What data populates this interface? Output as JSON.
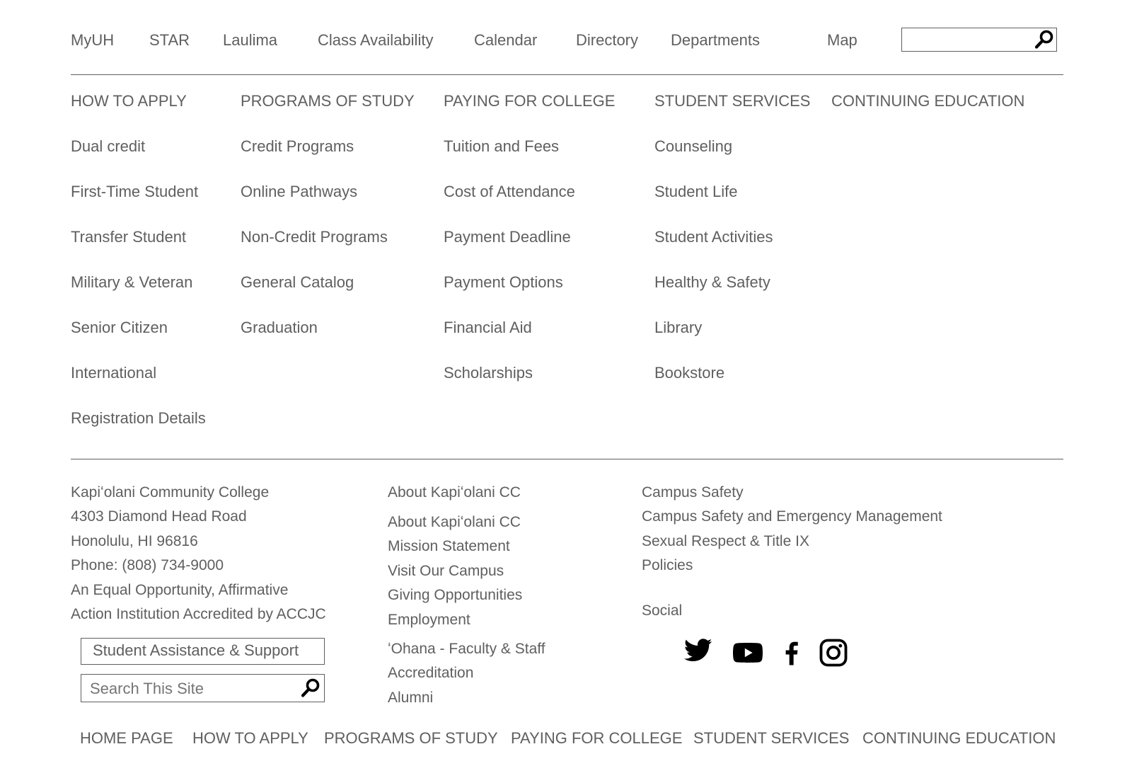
{
  "top_nav": {
    "items": [
      "MyUH",
      "STAR",
      "Laulima",
      "Class Availability",
      "Calendar",
      "Directory",
      "Departments",
      "Map"
    ],
    "search": {
      "value": "",
      "icon": "search-icon"
    }
  },
  "mega_menu": {
    "columns": [
      {
        "heading": "HOW TO APPLY",
        "items": [
          "Dual credit",
          "First-Time Student",
          "Transfer Student",
          "Military & Veteran",
          "Senior Citizen",
          "International",
          "Registration Details"
        ]
      },
      {
        "heading": "PROGRAMS OF STUDY",
        "items": [
          "Credit Programs",
          "Online Pathways",
          "Non-Credit Programs",
          "General Catalog",
          "Graduation"
        ]
      },
      {
        "heading": "PAYING FOR COLLEGE",
        "items": [
          "Tuition and Fees",
          "Cost of Attendance",
          "Payment Deadline",
          "Payment Options",
          "Financial Aid",
          "Scholarships"
        ]
      },
      {
        "heading": "STUDENT SERVICES",
        "items": [
          "Counseling",
          "Student Life",
          "Student Activities",
          "Healthy & Safety",
          "Library",
          "Bookstore"
        ]
      },
      {
        "heading": "CONTINUING EDUCATION",
        "items": []
      }
    ]
  },
  "footer": {
    "address": {
      "college": "Kapiʻolani Community College",
      "street": "4303 Diamond Head Road",
      "city": "Honolulu, HI 96816",
      "phone": "Phone: (808) 734-9000",
      "eo_line1": "An Equal Opportunity, Affirmative",
      "eo_line2": "Action Institution Accredited by ACCJC"
    },
    "assistance_button": "Student Assistance & Support",
    "site_search": {
      "placeholder": "Search This Site",
      "icon": "search-icon"
    },
    "about": {
      "heading": "About Kapiʻolani CC",
      "links": [
        "About Kapiʻolani CC",
        "Mission Statement",
        "Visit Our Campus",
        "Giving Opportunities",
        "Employment",
        "ʻOhana - Faculty & Staff",
        "Accreditation",
        "Alumni"
      ]
    },
    "safety": {
      "heading": "Campus Safety",
      "links": [
        "Campus Safety and Emergency Management",
        "Sexual Respect & Title IX",
        "Policies"
      ]
    },
    "social": {
      "heading": "Social",
      "icons": [
        "twitter-icon",
        "youtube-icon",
        "facebook-icon",
        "instagram-icon"
      ]
    }
  },
  "bottom_nav": {
    "items": [
      "HOME PAGE",
      "HOW TO APPLY",
      "PROGRAMS OF STUDY",
      "PAYING FOR COLLEGE",
      "STUDENT SERVICES",
      "CONTINUING EDUCATION"
    ]
  }
}
